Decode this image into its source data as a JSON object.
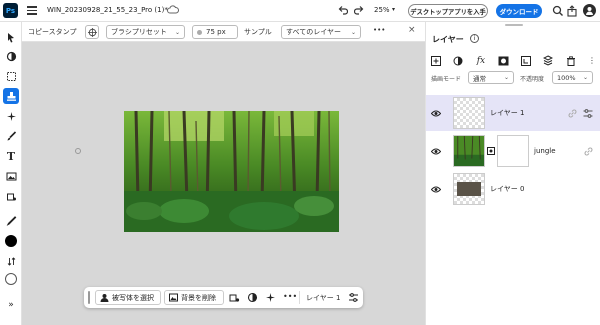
{
  "header": {
    "logo": "Ps",
    "doc_title": "WIN_20230928_21_55_23_Pro (1)*",
    "zoom": "25%",
    "desktop_button": "デスクトップアプリを入手",
    "download_button": "ダウンロード",
    "avatar_initial": "●"
  },
  "options": {
    "tool_name": "コピースタンプ",
    "brush_preset": "ブラシプリセット",
    "size": "75 px",
    "sample_label": "サンプル",
    "sample_value": "すべてのレイヤー",
    "more": "•••",
    "close": "×"
  },
  "context_bar": {
    "select_subject": "被写体を選択",
    "remove_background": "背景を削除",
    "more": "•••",
    "layer_label": "レイヤー 1"
  },
  "panel": {
    "title": "レイヤー",
    "blend_label": "描画モード",
    "blend_value": "通常",
    "opacity_label": "不透明度",
    "opacity_value": "100%",
    "layers": [
      {
        "name": "レイヤー 1",
        "selected": true
      },
      {
        "name": "jungle",
        "selected": false
      },
      {
        "name": "レイヤー 0",
        "selected": false
      }
    ]
  },
  "colors": {
    "accent": "#1473e6",
    "selection": "#e5e4f7",
    "canvas": "#d7d7d7"
  }
}
